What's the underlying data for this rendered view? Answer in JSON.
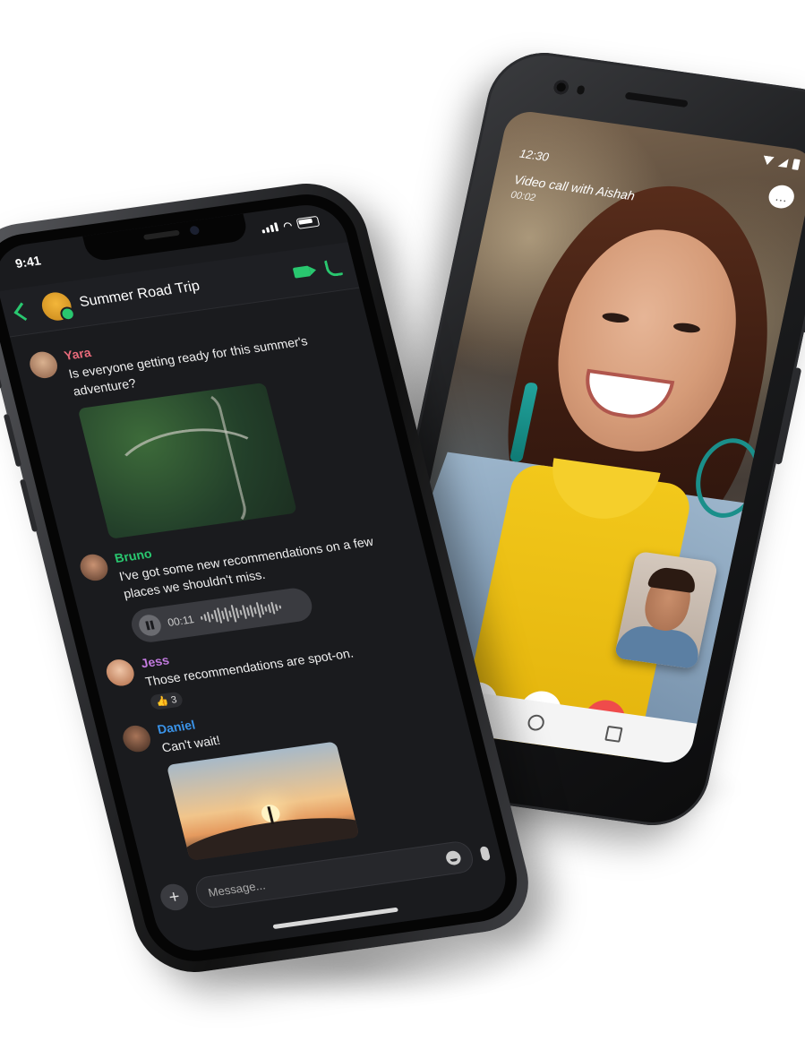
{
  "android": {
    "status_time": "12:30",
    "call_title": "Video call with Aishah",
    "call_duration": "00:02",
    "more_label": "..."
  },
  "iphone": {
    "status_time": "9:41",
    "chat_title": "Summer Road Trip",
    "messages": [
      {
        "name": "Yara",
        "color": "#e86a7a",
        "text": "Is everyone getting ready for this summer's adventure?"
      },
      {
        "name": "Bruno",
        "color": "#29c76f",
        "text": "I've got some new recommendations on a few places we shouldn't miss.",
        "voice_time": "00:11"
      },
      {
        "name": "Jess",
        "color": "#c37be0",
        "text": "Those recommendations are spot-on.",
        "reaction": "👍 3"
      },
      {
        "name": "Daniel",
        "color": "#3a93e8",
        "text": "Can't wait!"
      }
    ],
    "composer": {
      "placeholder": "Message..."
    },
    "plus_label": "+"
  },
  "colors": {
    "accent": "#29c76f",
    "end_call": "#ef4b4b"
  }
}
